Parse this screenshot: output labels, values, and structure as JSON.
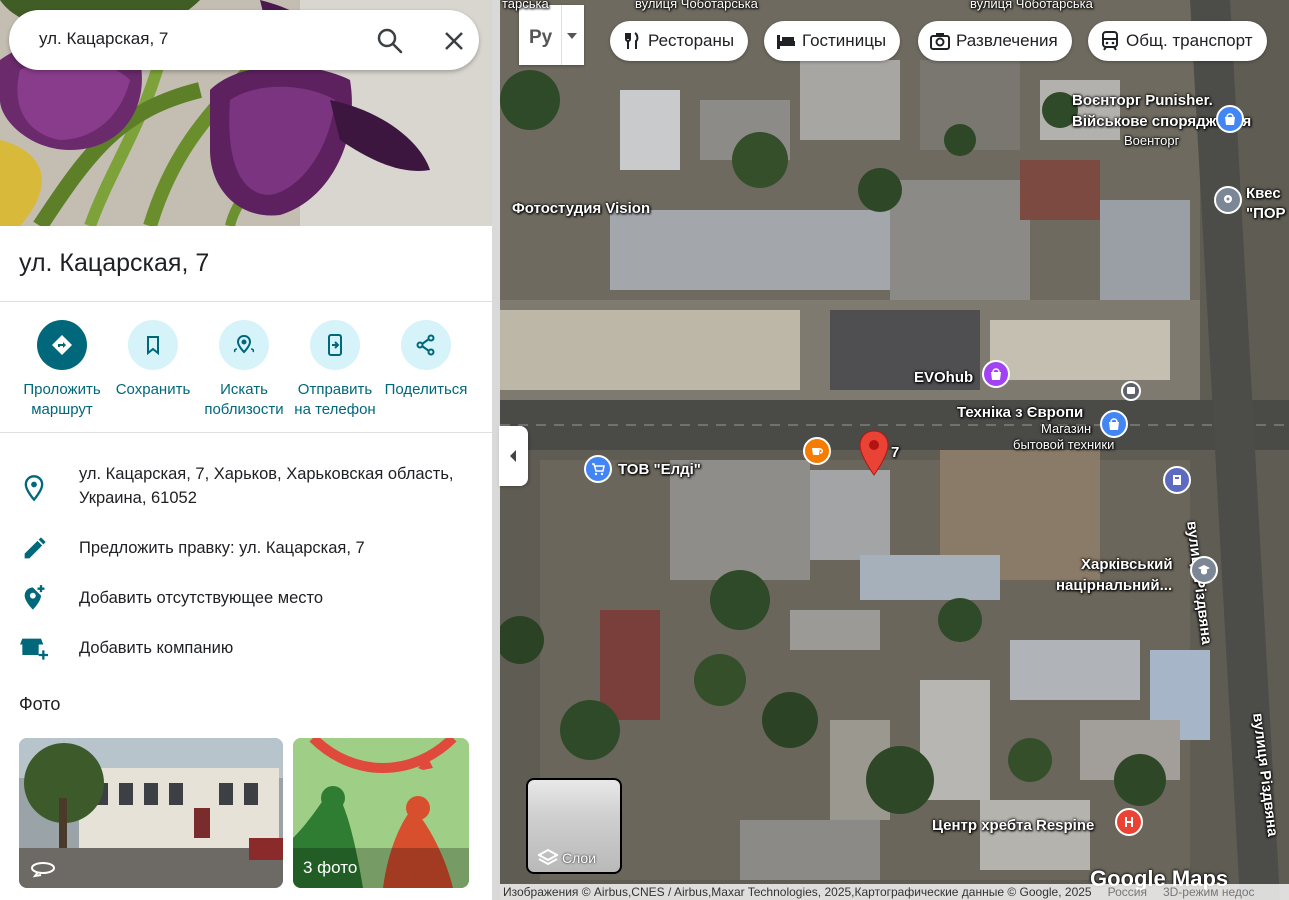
{
  "search": {
    "value": "ул. Кацарская, 7"
  },
  "place": {
    "title": "ул. Кацарская, 7"
  },
  "actions": [
    {
      "label": "Проложить маршрут",
      "icon": "directions-icon"
    },
    {
      "label": "Сохранить",
      "icon": "bookmark-icon"
    },
    {
      "label": "Искать поблизости",
      "icon": "nearby-icon"
    },
    {
      "label": "Отправить на телефон",
      "icon": "send-to-phone-icon"
    },
    {
      "label": "Поделиться",
      "icon": "share-icon"
    }
  ],
  "info": {
    "address": "ул. Кацарская, 7, Харьков, Харьковская область, Украина, 61052",
    "suggest_edit": "Предложить правку: ул. Кацарская, 7",
    "add_missing_place": "Добавить отсутствующее место",
    "add_business": "Добавить компанию"
  },
  "photos": {
    "title": "Фото",
    "second_label": "3 фото"
  },
  "map": {
    "lang_button": "Ру",
    "chips": [
      "Рестораны",
      "Гостиницы",
      "Развлечения",
      "Общ. транспорт"
    ],
    "labels": {
      "street_top_left": "вулиця Чоботарська",
      "street_top_right": "вулиця Чоботарська",
      "street_corner": "тарська",
      "voentorg_1": "Воєнторг Punisher.",
      "voentorg_2": "Військове спорядження",
      "voentorg_3": "Военторг",
      "quest_1": "Квес",
      "quest_2": "\"ПОР",
      "photostudio": "Фотостудия Vision",
      "evohub": "EVOhub",
      "tekhnika": "Техніка з Європи",
      "tekhnika_sub_1": "Магазин",
      "tekhnika_sub_2": "бытовой техники",
      "eldi": "ТОВ \"Елді\"",
      "pin_num": "7",
      "kharkiv_1": "Харківський",
      "kharkiv_2": "націрнальний...",
      "respine": "Центр хребта Respine",
      "rizdvyana_1": "вулиця Різдвяна",
      "rizdvyana_2": "вулиця Різдвяна"
    },
    "layers_label": "Слои",
    "logo": "Google Maps",
    "attribution": "Изображения © Airbus,CNES / Airbus,Maxar Technologies, 2025,Картографические данные © Google, 2025",
    "country": "Россия",
    "mode_3d": "3D-режим недос"
  },
  "colors": {
    "accent": "#00687a",
    "accent_light": "#d5f3f8",
    "pin": "#ea4335"
  }
}
